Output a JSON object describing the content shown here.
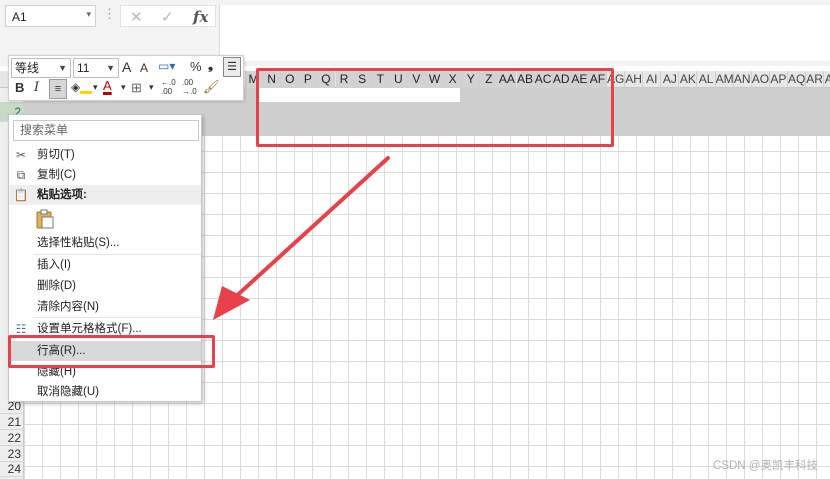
{
  "formula_bar": {
    "name_box": "A1",
    "dots": "⋮",
    "cancel_icon": "✕",
    "enter_icon": "✓",
    "fx_label": "fx"
  },
  "columns": [
    {
      "label": "M",
      "sel": true
    },
    {
      "label": "N",
      "sel": true
    },
    {
      "label": "O",
      "sel": true
    },
    {
      "label": "P",
      "sel": true
    },
    {
      "label": "Q",
      "sel": true
    },
    {
      "label": "R",
      "sel": true
    },
    {
      "label": "S",
      "sel": true
    },
    {
      "label": "T",
      "sel": true
    },
    {
      "label": "U",
      "sel": true
    },
    {
      "label": "V",
      "sel": true
    },
    {
      "label": "W",
      "sel": true
    },
    {
      "label": "X",
      "sel": true
    },
    {
      "label": "Y",
      "sel": true
    },
    {
      "label": "Z",
      "sel": true
    },
    {
      "label": "AA",
      "sel": true
    },
    {
      "label": "AB",
      "sel": true
    },
    {
      "label": "AC",
      "sel": true
    },
    {
      "label": "AD",
      "sel": true
    },
    {
      "label": "AE",
      "sel": true
    },
    {
      "label": "AF",
      "sel": true
    },
    {
      "label": "AG",
      "sel": false
    },
    {
      "label": "AH",
      "sel": false
    },
    {
      "label": "AI",
      "sel": false
    },
    {
      "label": "AJ",
      "sel": false
    },
    {
      "label": "AK",
      "sel": false
    },
    {
      "label": "AL",
      "sel": false
    },
    {
      "label": "AM",
      "sel": false
    },
    {
      "label": "AN",
      "sel": false
    },
    {
      "label": "AO",
      "sel": false
    },
    {
      "label": "AP",
      "sel": false
    },
    {
      "label": "AQ",
      "sel": false
    },
    {
      "label": "AR",
      "sel": false
    },
    {
      "label": "AS",
      "sel": false
    }
  ],
  "rows": [
    {
      "label": "2",
      "sel": true
    },
    {
      "label": "20",
      "sel": false
    },
    {
      "label": "21",
      "sel": false
    },
    {
      "label": "22",
      "sel": false
    },
    {
      "label": "23",
      "sel": false
    },
    {
      "label": "24",
      "sel": false
    }
  ],
  "mini_toolbar": {
    "font_name": "等线",
    "font_size": "11",
    "grow_font_icon": "A",
    "shrink_font_icon": "A",
    "percent": "%",
    "comma": "❟",
    "bold": "B",
    "italic": "I",
    "font_color": "A",
    "inc_decimal": ".00",
    "dec_decimal": ".0"
  },
  "context_menu": {
    "search_placeholder": "搜索菜单",
    "items": {
      "cut": "剪切(T)",
      "copy": "复制(C)",
      "paste_options": "粘贴选项:",
      "paste_special": "选择性粘贴(S)...",
      "insert": "插入(I)",
      "delete": "删除(D)",
      "clear": "清除内容(N)",
      "format_cells": "设置单元格格式(F)...",
      "row_height": "行高(R)...",
      "hide": "隐藏(H)",
      "unhide": "取消隐藏(U)"
    }
  },
  "colors": {
    "annotation_red": "#e8414a",
    "selection_gray": "#cfcfcf"
  },
  "watermark": "CSDN @奥凯丰科技"
}
